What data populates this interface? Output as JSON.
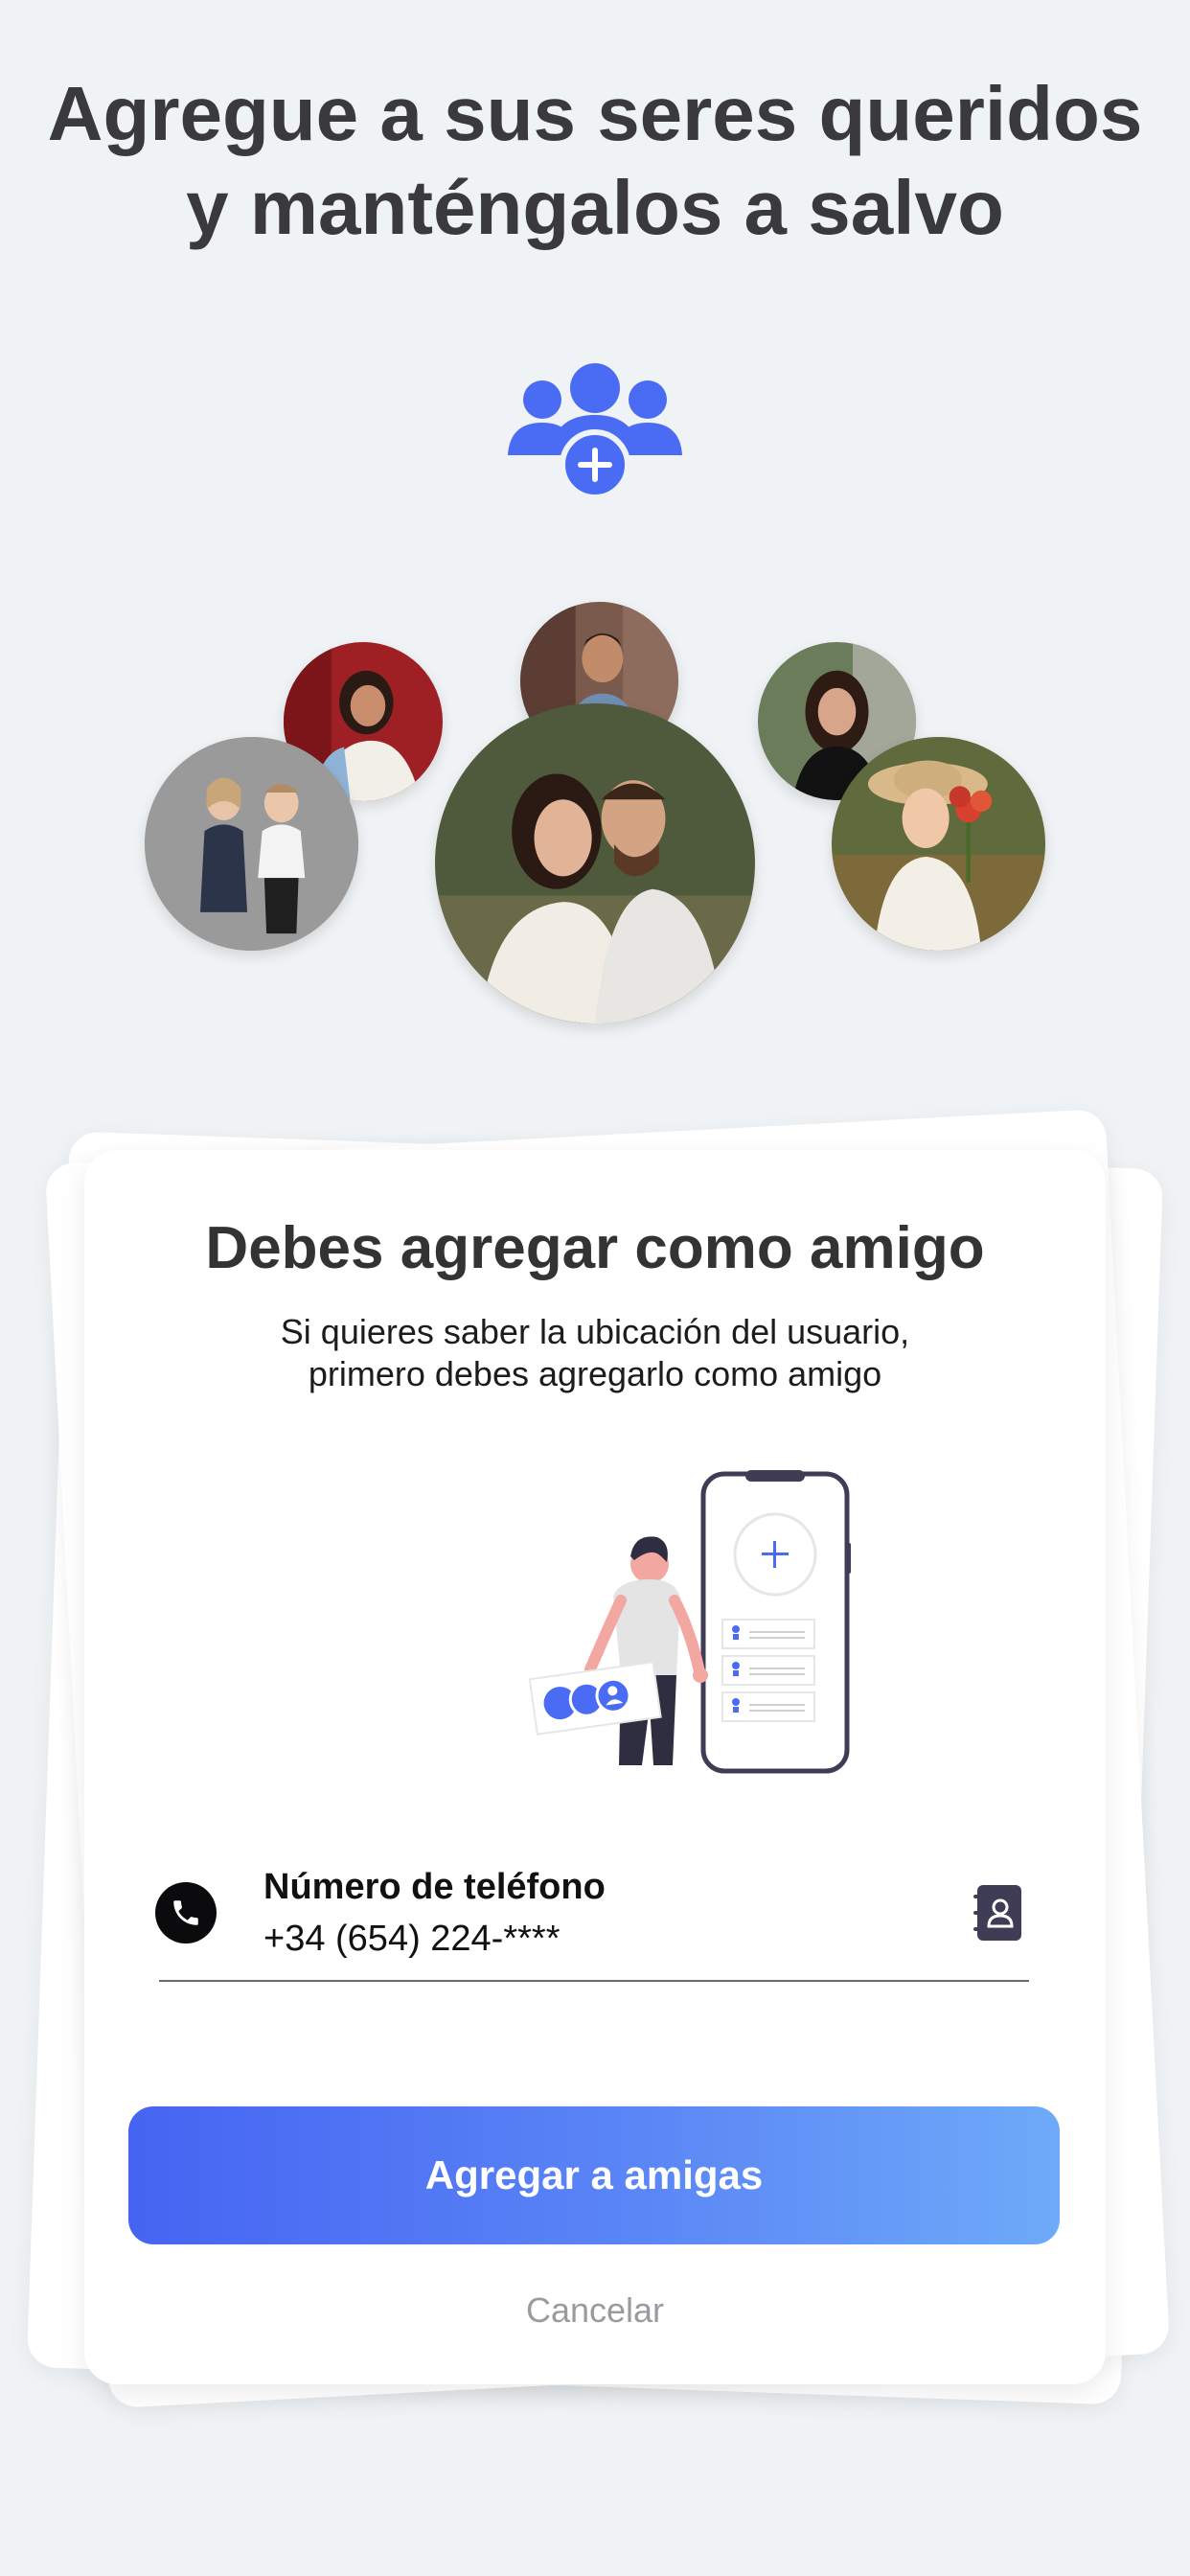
{
  "headline": {
    "line1": "Agregue a sus seres queridos",
    "line2": "y manténgalos a salvo"
  },
  "icons": {
    "group_add": "add-group-icon",
    "phone": "phone-icon",
    "contacts": "contact-book-icon"
  },
  "photos": [
    "photo-woman-red-wall",
    "photo-man-brick",
    "photo-woman-dark-hair",
    "photo-two-children",
    "photo-couple",
    "photo-woman-hat-flowers"
  ],
  "card": {
    "title": "Debes agregar como amigo",
    "subtitle_line1": "Si quieres saber la ubicación del usuario,",
    "subtitle_line2": "primero debes agregarlo como amigo",
    "phone_label": "Número de teléfono",
    "phone_value": "+34 (654) 224-****",
    "primary_button": "Agregar a amigas",
    "cancel": "Cancelar"
  },
  "colors": {
    "background": "#f0f3f5",
    "accent": "#4a6cf4",
    "accent_light": "#6eaaf8",
    "text_dark": "#3a3a3c",
    "muted": "#9b9b9f"
  }
}
